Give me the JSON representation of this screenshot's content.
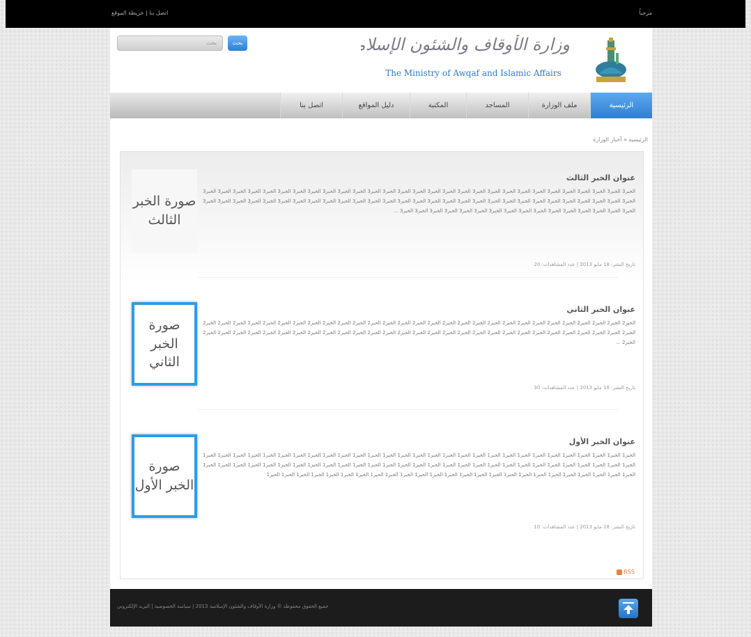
{
  "topbar": {
    "links": "اتصل بنا | خريطة الموقع",
    "right_text": "مرحباً"
  },
  "header": {
    "search_placeholder": "بحث",
    "search_button": "بحث",
    "logo_ar": "وزارة الأوقاف والشئون الإسلامية",
    "logo_en": "The Ministry of Awqaf and Islamic Affairs"
  },
  "nav": {
    "items": [
      "الرئيسية",
      "ملف الوزارة",
      "المساجد",
      "المكتبة",
      "دليل المواقع",
      "اتصل بنا"
    ]
  },
  "breadcrumb": "الرئيسية « أخبار الوزارة",
  "news": [
    {
      "thumb_text": "صورة الخبر الثالث",
      "title": "عنوان الخبر الثالث",
      "body": "الخبر3 الخبر3 الخبر3 الخبر3 الخبر3 الخبر3 الخبر3 الخبر3 الخبر3 الخبر3 الخبر3 الخبر3 الخبر3 الخبر3 الخبر3 الخبر3 الخبر3 الخبر3 الخبر3 الخبر3 الخبر3 الخبر3 الخبر3 الخبر3 الخبر3 الخبر3 الخبر3 الخبر3 الخبر3 الخبر3 الخبر3 الخبر3 الخبر3 الخبر3 الخبر3 الخبر3 الخبر3 الخبر3 الخبر3 الخبر3 الخبر3 الخبر3 الخبر3 الخبر3 الخبر3 الخبر3 الخبر3 الخبر3 الخبر3 الخبر3 الخبر3 الخبر3 الخبر3 الخبر3 الخبر3 الخبر3 الخبر3 الخبر3 الخبر3 الخبر3 الخبر3 الخبر3 الخبر3 الخبر3 الخبر3 الخبر3 الخبر3 الخبر3 الخبر3 الخبر3 الخبر3 الخبر3 الخبر3 الخبر3 ...",
      "meta": "تاريخ النشر: 18 مايو 2013 | عدد المشاهدات: 20"
    },
    {
      "thumb_text": "صورة الخبر الثاني",
      "title": "عنوان الخبر الثاني",
      "body": "الخبر2 الخبر2 الخبر2 الخبر2 الخبر2 الخبر2 الخبر2 الخبر2 الخبر2 الخبر2 الخبر2 الخبر2 الخبر2 الخبر2 الخبر2 الخبر2 الخبر2 الخبر2 الخبر2 الخبر2 الخبر2 الخبر2 الخبر2 الخبر2 الخبر2 الخبر2 الخبر2 الخبر2 الخبر2 الخبر2 الخبر2 الخبر2 الخبر2 الخبر2 الخبر2 الخبر2 الخبر2 الخبر2 الخبر2 الخبر2 الخبر2 الخبر2 الخبر2 الخبر2 الخبر2 الخبر2 الخبر2 الخبر2 الخبر2 الخبر2 الخبر2 الخبر2 الخبر2 الخبر2 الخبر2 الخبر2 الخبر2 الخبر2 الخبر2 ...",
      "meta": "تاريخ النشر: 18 مايو 2013 | عدد المشاهدات: 30"
    },
    {
      "thumb_text": "صورة الخبر الأول",
      "title": "عنوان الخبر الأول",
      "body": "الخبر1 الخبر1 الخبر1 الخبر1 الخبر1 الخبر1 الخبر1 الخبر1 الخبر1 الخبر1 الخبر1 الخبر1 الخبر1 الخبر1 الخبر1 الخبر1 الخبر1 الخبر1 الخبر1 الخبر1 الخبر1 الخبر1 الخبر1 الخبر1 الخبر1 الخبر1 الخبر1 الخبر1 الخبر1 الخبر1 الخبر1 الخبر1 الخبر1 الخبر1 الخبر1 الخبر1 الخبر1 الخبر1 الخبر1 الخبر1 الخبر1 الخبر1 الخبر1 الخبر1 الخبر1 الخبر1 الخبر1 الخبر1 الخبر1 الخبر1 الخبر1 الخبر1 الخبر1 الخبر1 الخبر1 الخبر1 الخبر1 الخبر1 الخبر1 الخبر1 الخبر1 الخبر1 الخبر1 الخبر1 الخبر1 الخبر1 الخبر1 الخبر1 الخبر1 الخبر1 الخبر1 الخبر1 الخبر1 الخبر1 الخبر1 الخبر1 الخبر1 الخبر1 الخبر1 الخبر1 الخبر1 الخبر1 الخبر1",
      "meta": "تاريخ النشر: 18 مايو 2013 | عدد المشاهدات: 10"
    }
  ],
  "rss_label": "RSS",
  "footer": {
    "text": "جميع الحقوق محفوظة © وزارة الأوقاف والشئون الإسلامية 2013 | سياسة الخصوصية | البريد الإلكتروني"
  },
  "colors": {
    "accent": "#2f7fd0",
    "frame": "#2c9ce6",
    "topbar": "#000000",
    "footer": "#1c1c1c"
  },
  "icons": {
    "scroll_top": "arrow-up-icon",
    "emblem": "mosque-emblem-icon",
    "rss": "rss-icon"
  }
}
